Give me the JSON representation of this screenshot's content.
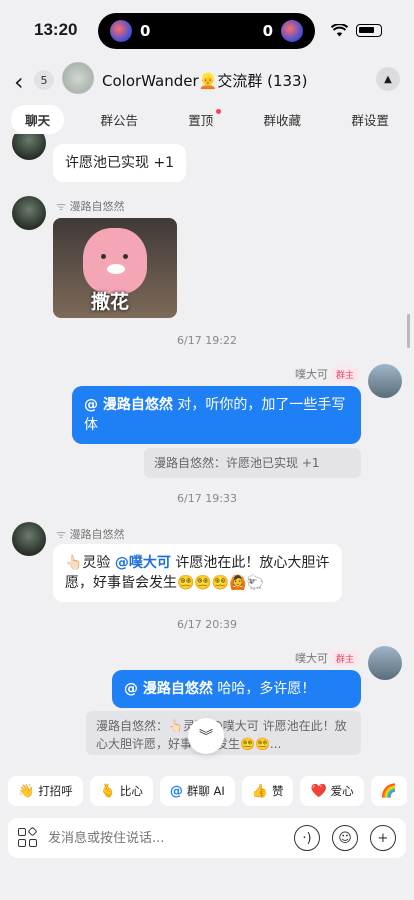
{
  "status_bar": {
    "time": "13:20",
    "score_left": "0",
    "score_right": "0"
  },
  "header": {
    "back_icon": "chevron-left-icon",
    "unread_count": "5",
    "title": "ColorWander👱交流群 (133)"
  },
  "tabs": [
    {
      "label": "聊天",
      "active": true
    },
    {
      "label": "群公告"
    },
    {
      "label": "置顶",
      "has_dot": true
    },
    {
      "label": "群收藏"
    },
    {
      "label": "群设置"
    }
  ],
  "messages": {
    "m1": {
      "text": "许愿池已实现 +1"
    },
    "m2": {
      "sender": "漫路自悠然",
      "sticker_text": "撒花"
    },
    "t1": "6/17 19:22",
    "m3": {
      "sender": "噗大可",
      "role": "群主",
      "mention": "@ 漫路自悠然",
      "text": " 对，听你的，加了一些手写体"
    },
    "q1": {
      "text": "漫路自悠然：许愿池已实现 +1"
    },
    "t2": "6/17 19:33",
    "m4": {
      "sender": "漫路自悠然",
      "prefix": "👆🏻灵验",
      "mention": "@噗大可",
      "text": " 许愿池在此！放心大胆许愿，好事皆会发生😵‍💫😵‍💫😵‍💫🙆🐑"
    },
    "t3": "6/17 20:39",
    "m5": {
      "sender": "噗大可",
      "role": "群主",
      "mention": "@ 漫路自悠然",
      "text": " 哈哈，多许愿！"
    },
    "q2": {
      "text": "漫路自悠然：👆🏻灵验 @噗大可 许愿池在此！放心大胆许愿，好事皆会发生😵‍💫😵‍💫..."
    }
  },
  "quick_actions": [
    {
      "icon": "👋",
      "label": "打招呼"
    },
    {
      "icon": "🫰",
      "label": "比心"
    },
    {
      "icon": "@",
      "label": "群聊 AI"
    },
    {
      "icon": "👍",
      "label": "赞"
    },
    {
      "icon": "❤️",
      "label": "爱心"
    },
    {
      "icon": "🌈",
      "label": ""
    }
  ],
  "composer": {
    "placeholder": "发消息或按住说话..."
  },
  "colors": {
    "accent": "#1f7ff5",
    "owner_tag": "#e84868",
    "background": "#f0f0f2"
  }
}
